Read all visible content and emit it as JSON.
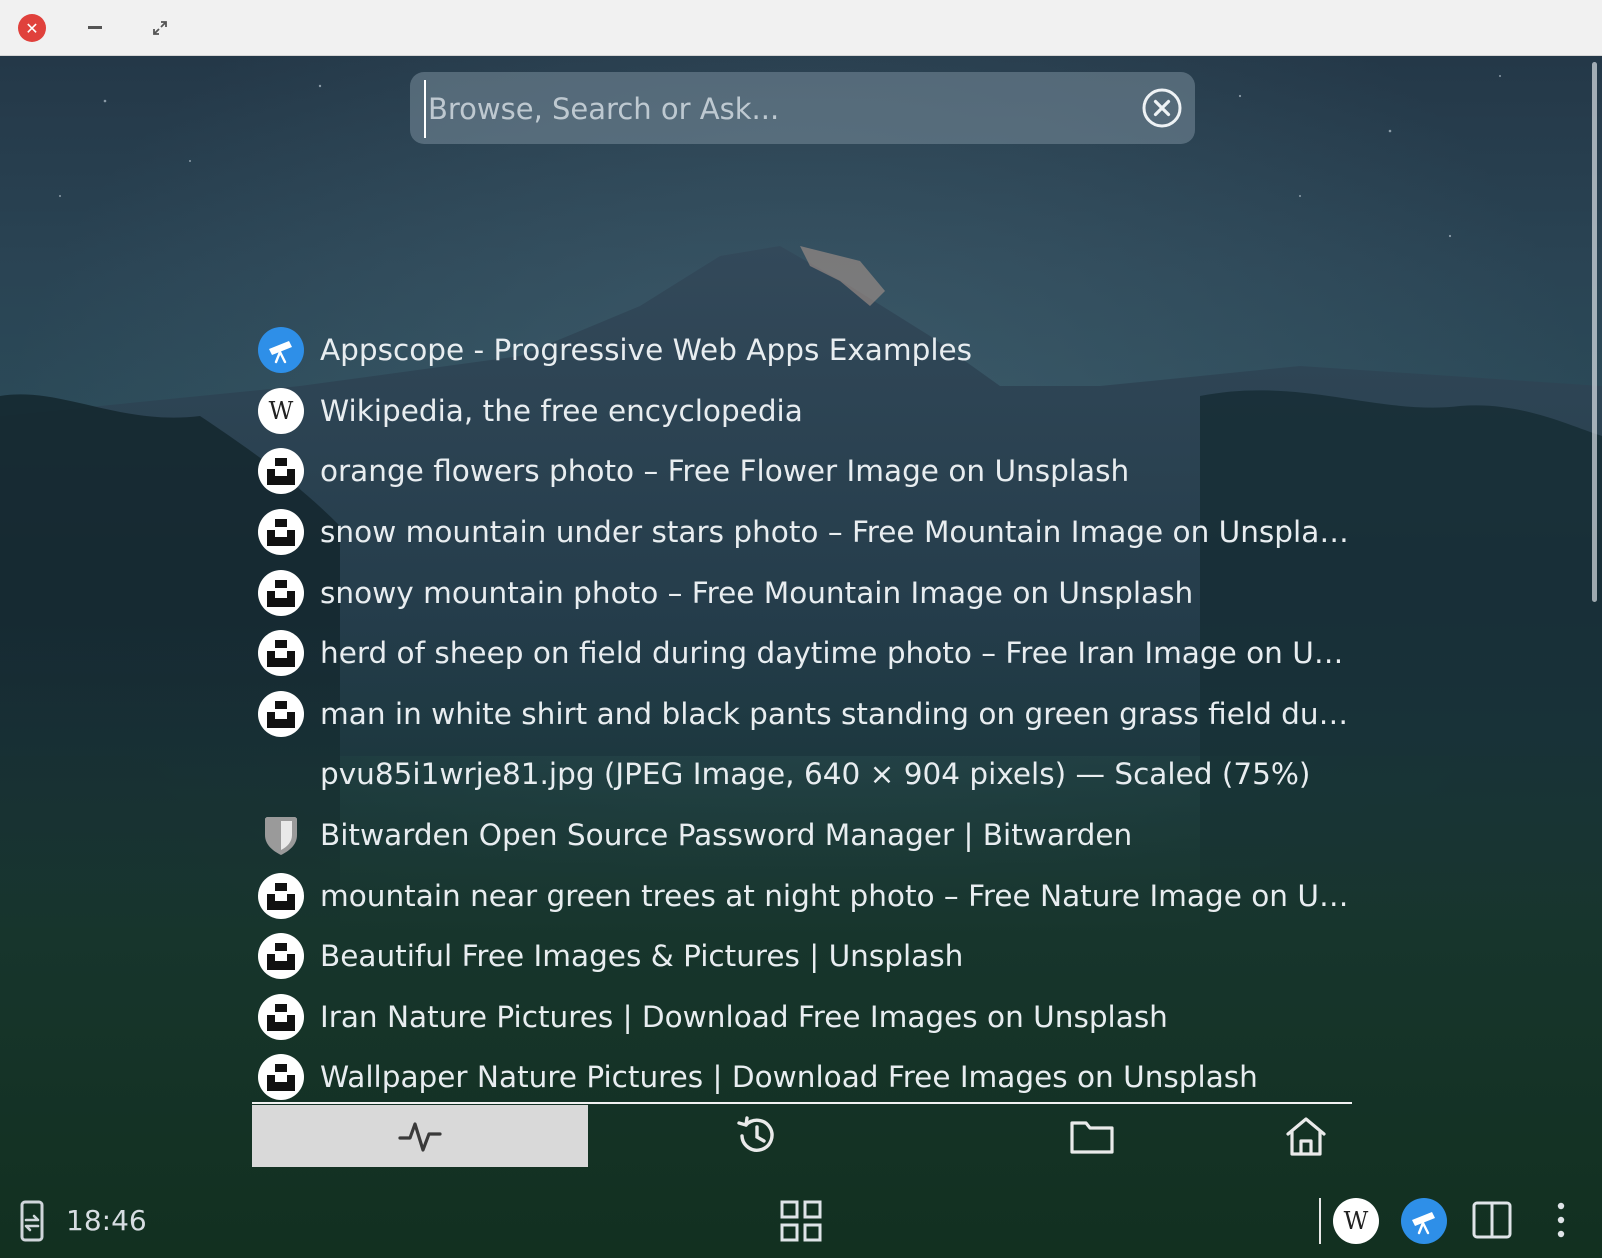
{
  "window": {
    "title_fragment": "",
    "close_glyph": "✕"
  },
  "search": {
    "placeholder": "Browse, Search or Ask...",
    "value": ""
  },
  "history": [
    {
      "icon": "appscope-icon",
      "title": "Appscope - Progressive Web Apps Examples"
    },
    {
      "icon": "wikipedia-icon",
      "title": "Wikipedia, the free encyclopedia"
    },
    {
      "icon": "unsplash-icon",
      "title": "orange flowers photo – Free Flower Image on Unsplash"
    },
    {
      "icon": "unsplash-icon",
      "title": "snow mountain under stars photo – Free Mountain Image on Unsplash"
    },
    {
      "icon": "unsplash-icon",
      "title": "snowy mountain photo – Free Mountain Image on Unsplash"
    },
    {
      "icon": "unsplash-icon",
      "title": "herd of sheep on field during daytime photo – Free Iran Image on Uns…"
    },
    {
      "icon": "unsplash-icon",
      "title": "man in white shirt and black pants standing on green grass field during…"
    },
    {
      "icon": "none",
      "title": "pvu85i1wrje81.jpg (JPEG Image, 640 × 904 pixels) — Scaled (75%)"
    },
    {
      "icon": "bitwarden-shield-icon",
      "title": "Bitwarden Open Source Password Manager | Bitwarden"
    },
    {
      "icon": "unsplash-icon",
      "title": "mountain near green trees at night photo – Free Nature Image on Uns…"
    },
    {
      "icon": "unsplash-icon",
      "title": "Beautiful Free Images & Pictures | Unsplash"
    },
    {
      "icon": "unsplash-icon",
      "title": "Iran Nature Pictures | Download Free Images on Unsplash"
    },
    {
      "icon": "unsplash-icon",
      "title": "Wallpaper Nature Pictures | Download Free Images on Unsplash"
    }
  ],
  "tabs": [
    {
      "icon": "activity-icon",
      "active": true
    },
    {
      "icon": "history-icon",
      "active": false
    },
    {
      "icon": "folder-icon",
      "active": false
    },
    {
      "icon": "home-icon",
      "active": false
    }
  ],
  "statusbar": {
    "clock": "18:46",
    "wikipedia_letter": "W",
    "pinned": [
      "wikipedia-icon",
      "appscope-icon"
    ]
  },
  "colors": {
    "accent_blue": "#2e8fe8",
    "close_red": "#e0413c",
    "active_tab": "#d9d9d9",
    "text": "#e8edf0"
  }
}
